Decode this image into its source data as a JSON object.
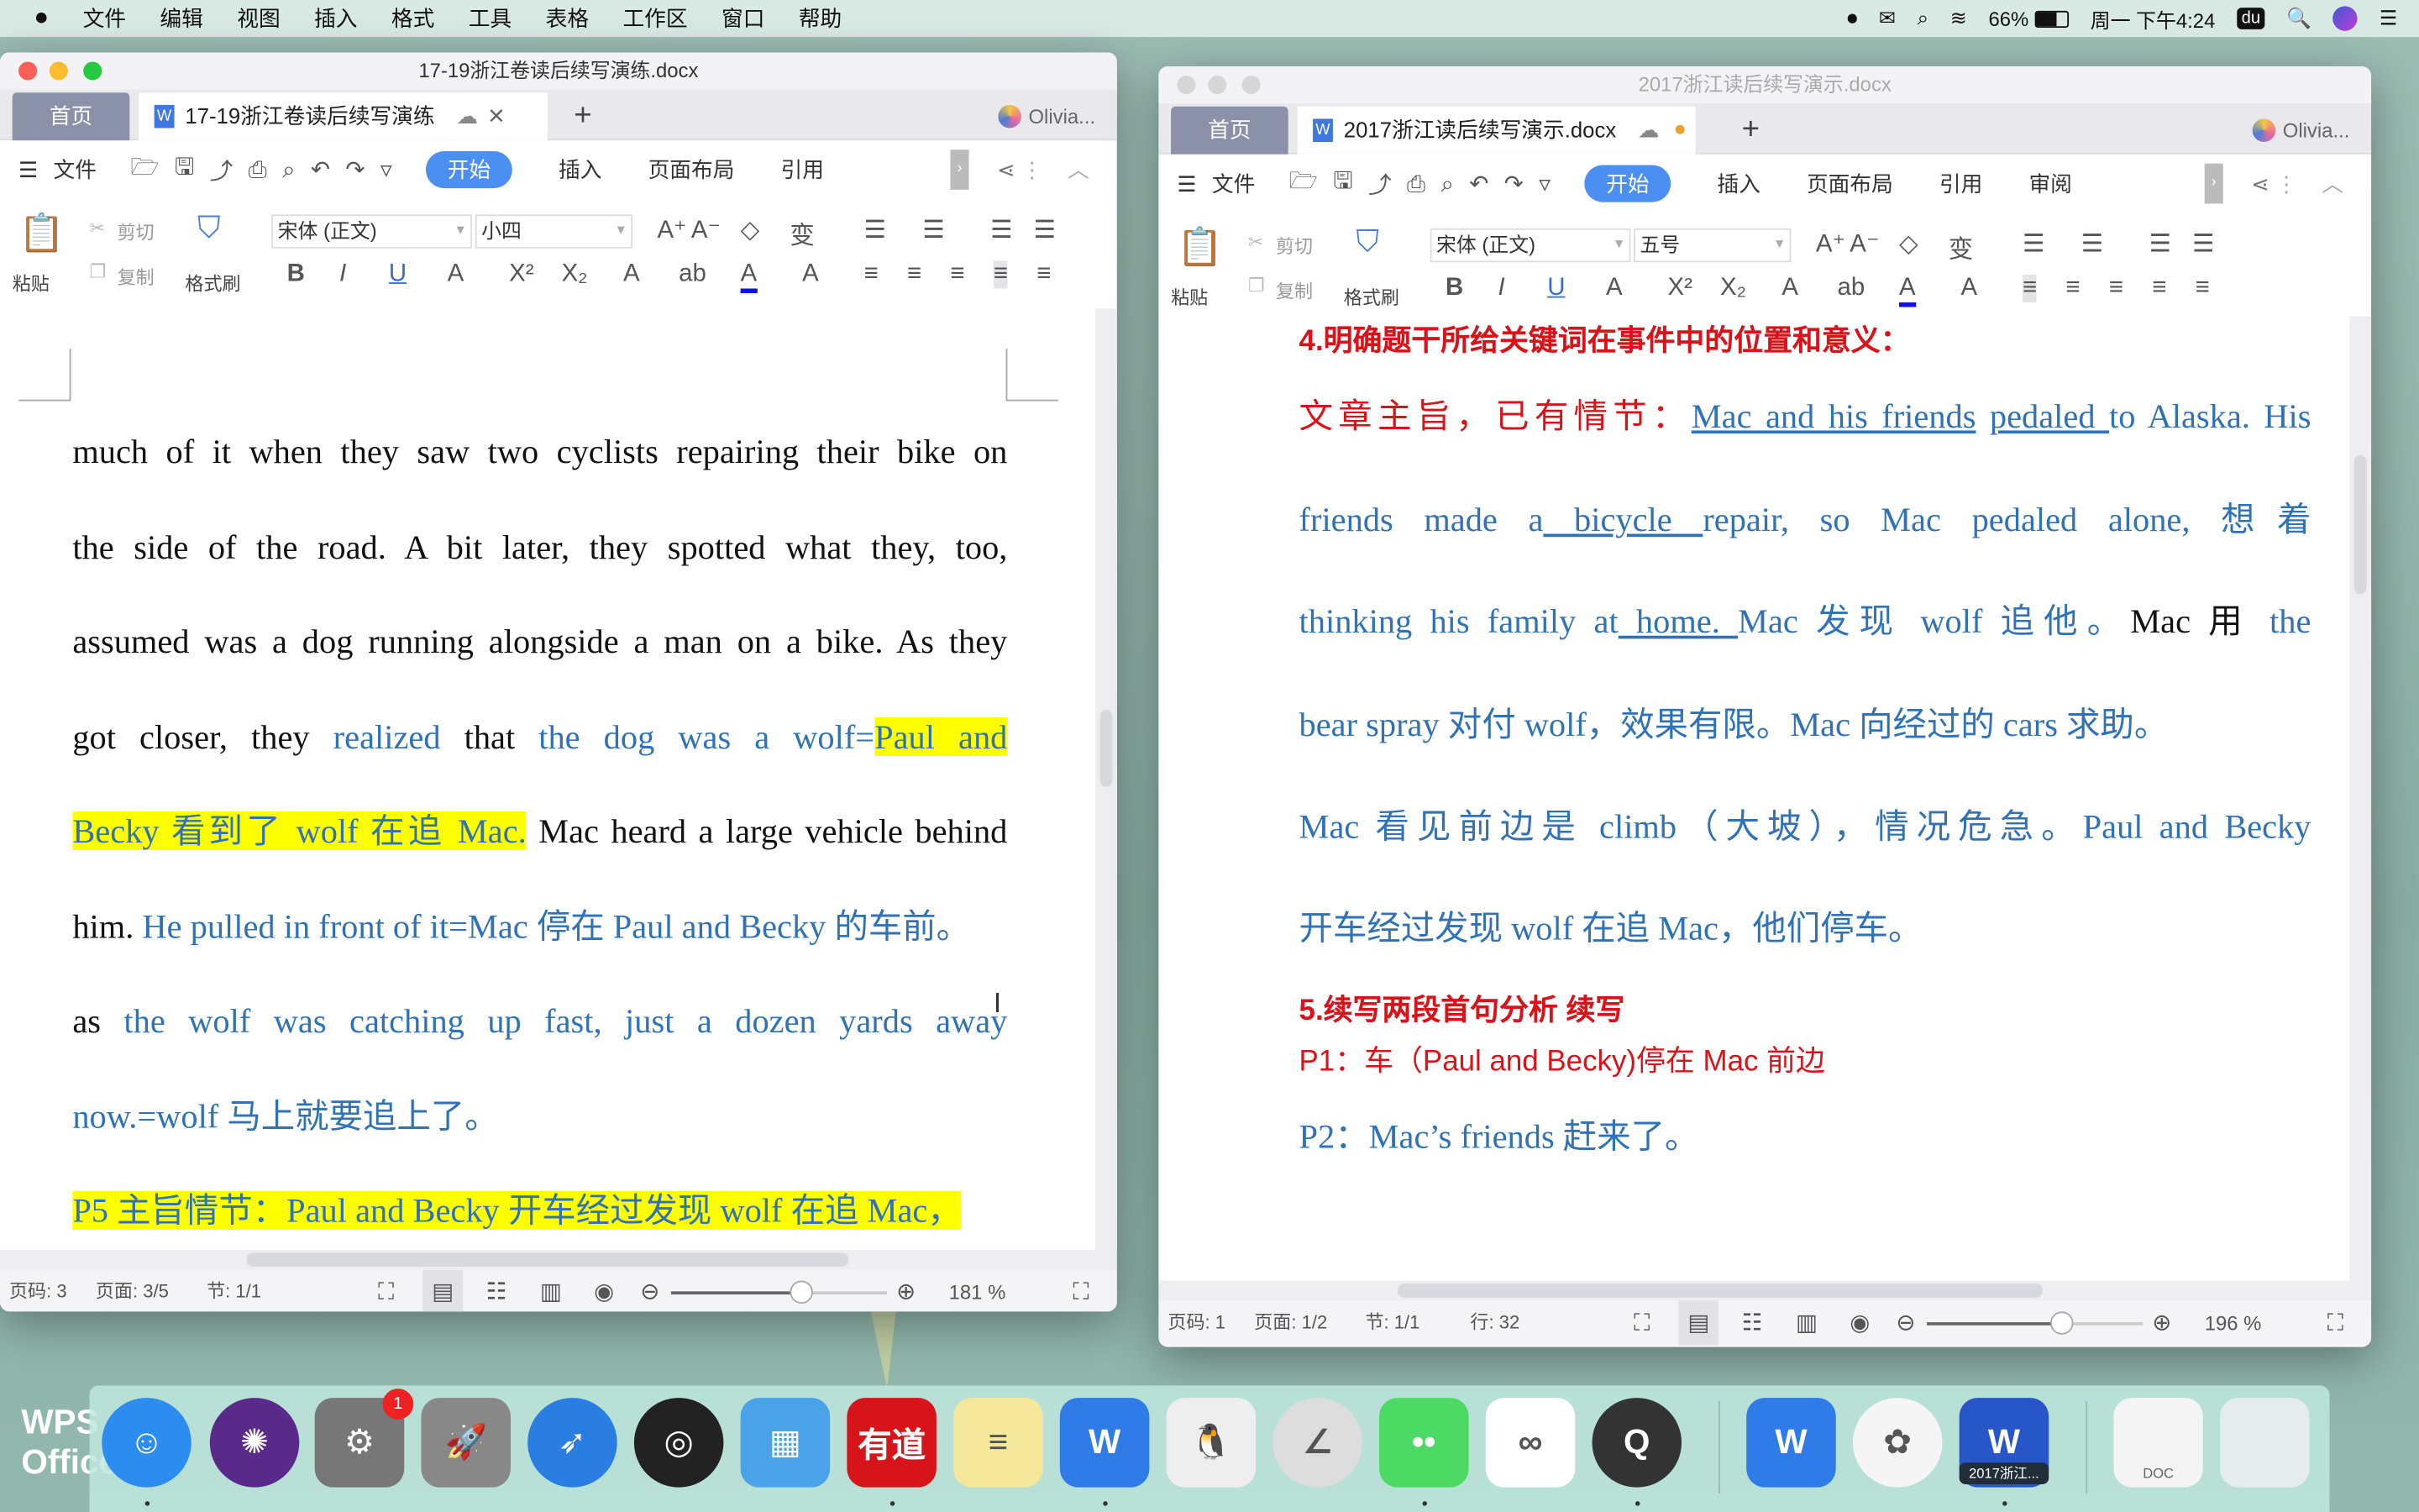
{
  "menubar": {
    "app_name": "WPS Office",
    "items": [
      "文件",
      "编辑",
      "视图",
      "插入",
      "格式",
      "工具",
      "表格",
      "工作区",
      "窗口",
      "帮助"
    ],
    "battery": "66%",
    "clock": "周一 下午4:24",
    "status_icons": [
      "record-icon",
      "wechat-icon",
      "search-q-icon",
      "wifi-icon",
      "battery-icon",
      "du-icon",
      "spotlight-icon",
      "siri-icon",
      "list-icon"
    ]
  },
  "windows": [
    {
      "id": "left",
      "title": "17-19浙江卷读后续写演练.docx",
      "home_tab": "首页",
      "doc_tab": "17-19浙江卷读后续写演练",
      "user": "Olivia...",
      "ribbon": {
        "menu": "文件",
        "tabs": [
          "开始",
          "插入",
          "页面布局",
          "引用"
        ]
      },
      "toolbar": {
        "paste": "粘贴",
        "cut": "剪切",
        "copy": "复制",
        "format_painter": "格式刷",
        "font": "宋体 (正文)",
        "size": "小四"
      },
      "status": {
        "page_no": "页码: 3",
        "pages": "页面: 3/5",
        "section": "节: 1/1",
        "zoom": "181 %",
        "zoom_fraction": 0.6
      },
      "lines": [
        {
          "j": true,
          "segs": [
            {
              "t": "much of it when they saw two cyclists repairing their bike on",
              "c": "black"
            }
          ]
        },
        {
          "j": true,
          "segs": [
            {
              "t": "the side of the road. A bit later, they spotted what they, too,",
              "c": "black"
            }
          ]
        },
        {
          "j": true,
          "segs": [
            {
              "t": "assumed was a dog running alongside a man on a bike. As they",
              "c": "black"
            }
          ]
        },
        {
          "j": true,
          "segs": [
            {
              "t": "got closer, they ",
              "c": "black"
            },
            {
              "t": "realized",
              "c": "blue"
            },
            {
              "t": " that ",
              "c": "black"
            },
            {
              "t": "the dog was a wolf=",
              "c": "blue"
            },
            {
              "t": "Paul and",
              "c": "blue",
              "hl": true
            }
          ]
        },
        {
          "j": true,
          "segs": [
            {
              "t": "Becky 看到了 wolf 在追 Mac.",
              "c": "blue",
              "hl": true
            },
            {
              "t": " Mac heard a large vehicle behind",
              "c": "black"
            }
          ]
        },
        {
          "j": false,
          "segs": [
            {
              "t": "him. ",
              "c": "black"
            },
            {
              "t": "He pulled in front of it=Mac 停在 Paul and Becky 的车前。",
              "c": "blue"
            }
          ]
        },
        {
          "j": true,
          "segs": [
            {
              "t": "as ",
              "c": "black"
            },
            {
              "t": "the wolf was catching up fast, just a dozen yards away",
              "c": "blue"
            }
          ]
        },
        {
          "j": false,
          "segs": [
            {
              "t": "now.=wolf 马上就要追上了。",
              "c": "blue"
            }
          ]
        },
        {
          "j": false,
          "segs": [
            {
              "t": "P5 主旨情节：Paul and Becky 开车经过发现 wolf 在追 Mac，",
              "c": "blue",
              "hl": true
            }
          ]
        }
      ]
    },
    {
      "id": "right",
      "title": "2017浙江读后续写演示.docx",
      "home_tab": "首页",
      "doc_tab": "2017浙江读后续写演示.docx",
      "user": "Olivia...",
      "ribbon": {
        "menu": "文件",
        "tabs": [
          "开始",
          "插入",
          "页面布局",
          "引用",
          "审阅"
        ]
      },
      "toolbar": {
        "paste": "粘贴",
        "cut": "剪切",
        "copy": "复制",
        "format_painter": "格式刷",
        "font": "宋体 (正文)",
        "size": "五号"
      },
      "status": {
        "page_no": "页码: 1",
        "pages": "页面: 1/2",
        "section": "节: 1/1",
        "line": "行: 32",
        "zoom": "196 %",
        "zoom_fraction": 0.62
      },
      "lines": [
        {
          "j": false,
          "segs": [
            {
              "t": "4.明确题干所给关键词在事件中的位置和意义：",
              "c": "red",
              "sans": true,
              "bold": true
            }
          ]
        },
        {
          "j": true,
          "segs": [
            {
              "t": "文章主旨，已有情节：",
              "c": "red"
            },
            {
              "t": "Mac and his friends",
              "c": "blue",
              "u": true
            },
            {
              "t": " ",
              "c": "blue"
            },
            {
              "t": "pedaled ",
              "c": "blue",
              "u": true
            },
            {
              "t": "to Alaska. His",
              "c": "blue"
            }
          ]
        },
        {
          "j": true,
          "segs": [
            {
              "t": "friends made a",
              "c": "blue"
            },
            {
              "t": " bicycle ",
              "c": "blue",
              "u": true
            },
            {
              "t": "repair, so Mac pedaled alone, 想着",
              "c": "blue"
            }
          ]
        },
        {
          "j": true,
          "segs": [
            {
              "t": "thinking his family at",
              "c": "blue"
            },
            {
              "t": " home. ",
              "c": "blue",
              "u": true
            },
            {
              "t": "Mac 发现 wolf 追他。",
              "c": "blue"
            },
            {
              "t": "Mac 用 ",
              "c": "black"
            },
            {
              "t": "the",
              "c": "blue"
            }
          ]
        },
        {
          "j": false,
          "segs": [
            {
              "t": "bear spray 对付 wolf，效果有限。Mac 向经过的 cars 求助。",
              "c": "blue"
            }
          ]
        },
        {
          "j": true,
          "segs": [
            {
              "t": "Mac 看见前边是 climb（大坡），情况危急。Paul and Becky",
              "c": "blue"
            }
          ]
        },
        {
          "j": false,
          "segs": [
            {
              "t": "开车经过发现 wolf 在追 Mac，他们停车。",
              "c": "blue"
            }
          ]
        },
        {
          "j": false,
          "segs": [
            {
              "t": "5.续写两段首句分析 续写",
              "c": "red",
              "sans": true,
              "bold": true
            }
          ]
        },
        {
          "j": false,
          "segs": [
            {
              "t": "P1：车（Paul and Becky)停在 Mac 前边",
              "c": "red",
              "sans": true
            }
          ]
        },
        {
          "j": false,
          "segs": [
            {
              "t": "P2：Mac’s friends 赶来了。",
              "c": "blue"
            }
          ]
        }
      ]
    }
  ],
  "dock": {
    "apps": [
      {
        "name": "finder",
        "color": "#2d8cf0",
        "glyph": "☺"
      },
      {
        "name": "siri",
        "color": "#5a2a8a",
        "glyph": "✺"
      },
      {
        "name": "system-preferences",
        "color": "#777",
        "glyph": "⚙",
        "badge": "1"
      },
      {
        "name": "launchpad",
        "color": "#888",
        "glyph": "🚀"
      },
      {
        "name": "safari",
        "color": "#2a7de1",
        "glyph": "➶"
      },
      {
        "name": "obs",
        "color": "#222",
        "glyph": "◎"
      },
      {
        "name": "keynote",
        "color": "#4aa3e8",
        "glyph": "▦"
      },
      {
        "name": "youdao-dictionary",
        "color": "#d7141a",
        "glyph": "有道"
      },
      {
        "name": "notes",
        "color": "#f6e89a",
        "glyph": "≡"
      },
      {
        "name": "wps-office",
        "color": "#2f7be8",
        "glyph": "W"
      },
      {
        "name": "qq",
        "color": "#eee",
        "glyph": "🐧"
      },
      {
        "name": "writer-app",
        "color": "#ddd",
        "glyph": "∠"
      },
      {
        "name": "wechat",
        "color": "#4cd964",
        "glyph": "••"
      },
      {
        "name": "baidu-netdisk",
        "color": "#fff",
        "glyph": "∞"
      },
      {
        "name": "quicktime",
        "color": "#333",
        "glyph": "Q"
      },
      {
        "name": "wps-office-2",
        "color": "#2f7be8",
        "glyph": "W"
      },
      {
        "name": "photos",
        "color": "#f5f5f5",
        "glyph": "✿"
      },
      {
        "name": "wps-document",
        "color": "#2756c9",
        "glyph": "W",
        "label": "2017浙江..."
      },
      {
        "name": "doc-file",
        "color": "#f4f4f4",
        "glyph": "",
        "label": "DOC"
      },
      {
        "name": "trash",
        "color": "#e4ecec",
        "glyph": ""
      }
    ],
    "running": [
      0,
      7,
      9,
      12,
      14,
      17
    ]
  }
}
